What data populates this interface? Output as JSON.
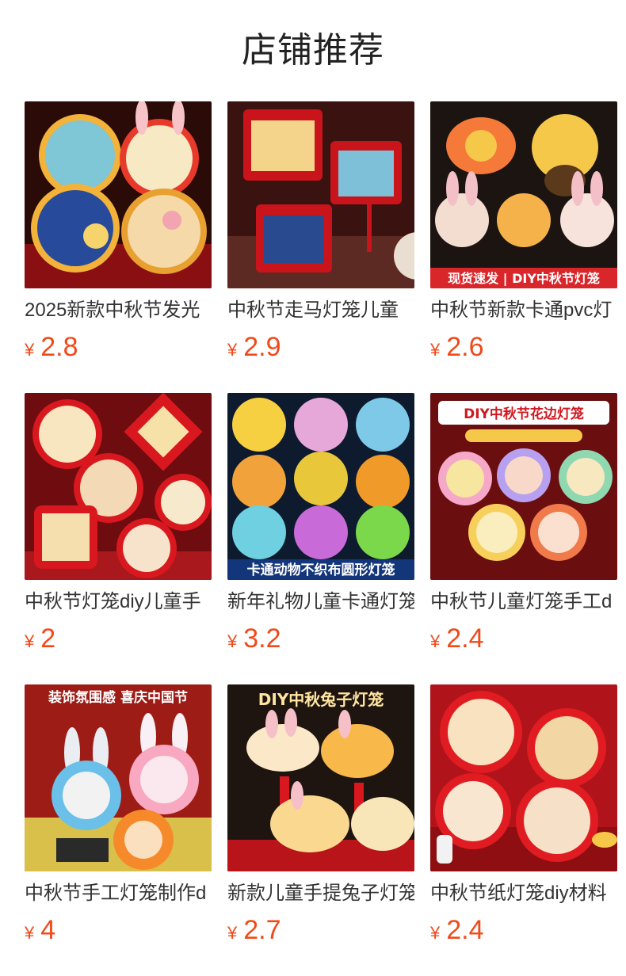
{
  "page_title": "店铺推荐",
  "currency_symbol": "¥",
  "products": [
    {
      "name": "2025新款中秋节发光",
      "price": "2.8",
      "image_overlay": ""
    },
    {
      "name": "中秋节走马灯笼儿童",
      "price": "2.9",
      "image_overlay": ""
    },
    {
      "name": "中秋节新款卡通pvc灯",
      "price": "2.6",
      "image_overlay": "现货速发 | DIY中秋节灯笼"
    },
    {
      "name": "中秋节灯笼diy儿童手",
      "price": "2",
      "image_overlay": ""
    },
    {
      "name": "新年礼物儿童卡通灯笼",
      "price": "3.2",
      "image_overlay": "卡通动物不织布圆形灯笼"
    },
    {
      "name": "中秋节儿童灯笼手工d",
      "price": "2.4",
      "image_overlay": "DIY中秋节花边灯笼"
    },
    {
      "name": "中秋节手工灯笼制作d",
      "price": "4",
      "image_overlay": "装饰氛围感 喜庆中国节"
    },
    {
      "name": "新款儿童手提兔子灯笼",
      "price": "2.7",
      "image_overlay": "DIY中秋兔子灯笼"
    },
    {
      "name": "中秋节纸灯笼diy材料",
      "price": "2.4",
      "image_overlay": ""
    }
  ],
  "colors": {
    "price": "#f04a1a",
    "lantern_red": "#d4141c",
    "gold": "#f6c84a"
  }
}
